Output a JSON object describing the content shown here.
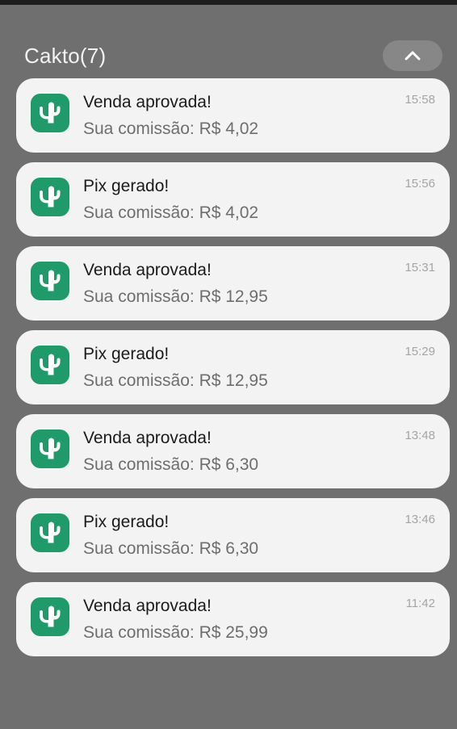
{
  "header": {
    "app_name": "Cakto(7)"
  },
  "colors": {
    "accent": "#1e9a6b",
    "background": "#6f6f6f",
    "card": "#f3f3f3"
  },
  "icons": {
    "collapse": "chevron-up-icon",
    "app": "cactus-icon"
  },
  "notifications": [
    {
      "title": "Venda aprovada!",
      "body": "Sua comissão: R$ 4,02",
      "time": "15:58"
    },
    {
      "title": "Pix gerado!",
      "body": "Sua comissão: R$ 4,02",
      "time": "15:56"
    },
    {
      "title": "Venda aprovada!",
      "body": "Sua comissão: R$ 12,95",
      "time": "15:31"
    },
    {
      "title": "Pix gerado!",
      "body": "Sua comissão: R$ 12,95",
      "time": "15:29"
    },
    {
      "title": "Venda aprovada!",
      "body": "Sua comissão: R$ 6,30",
      "time": "13:48"
    },
    {
      "title": "Pix gerado!",
      "body": "Sua comissão: R$ 6,30",
      "time": "13:46"
    },
    {
      "title": "Venda aprovada!",
      "body": "Sua comissão: R$ 25,99",
      "time": "11:42"
    }
  ]
}
